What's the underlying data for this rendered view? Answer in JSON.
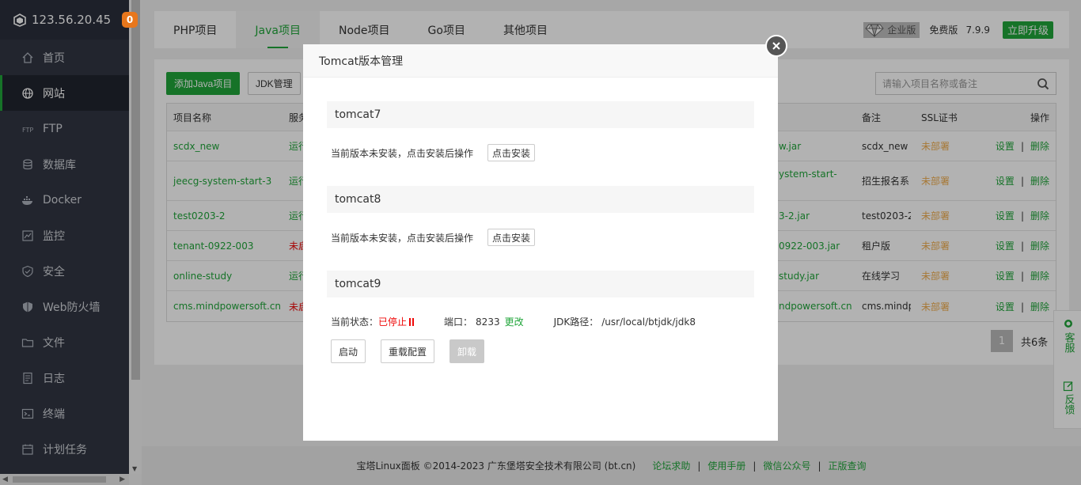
{
  "sidebar": {
    "ip": "123.56.20.45",
    "badge": "0",
    "items": [
      {
        "label": "首页",
        "icon": "home-icon"
      },
      {
        "label": "网站",
        "icon": "globe-icon"
      },
      {
        "label": "FTP",
        "icon": "ftp-icon"
      },
      {
        "label": "数据库",
        "icon": "database-icon"
      },
      {
        "label": "Docker",
        "icon": "docker-icon"
      },
      {
        "label": "监控",
        "icon": "monitor-icon"
      },
      {
        "label": "安全",
        "icon": "shield-icon"
      },
      {
        "label": "Web防火墙",
        "icon": "firewall-icon"
      },
      {
        "label": "文件",
        "icon": "folder-icon"
      },
      {
        "label": "日志",
        "icon": "log-icon"
      },
      {
        "label": "终端",
        "icon": "terminal-icon"
      },
      {
        "label": "计划任务",
        "icon": "calendar-icon"
      }
    ],
    "active_index": 1
  },
  "topnav": {
    "tabs": [
      "PHP项目",
      "Java项目",
      "Node项目",
      "Go项目",
      "其他项目"
    ],
    "active_index": 1,
    "enterprise": "企业版",
    "free": "免费版",
    "version": "7.9.9",
    "upgrade": "立即升级"
  },
  "toolbar": {
    "add_java": "添加Java项目",
    "jdk_manage": "JDK管理",
    "search_placeholder": "请输入项目名称或备注"
  },
  "table": {
    "headers": {
      "name": "项目名称",
      "status": "服务",
      "note": "备注",
      "ssl": "SSL证书",
      "op": "操作"
    },
    "rows": [
      {
        "name": "scdx_new",
        "status": "运行",
        "status_color": "green",
        "path": "w.jar",
        "note": "scdx_new",
        "ssl": "未部署"
      },
      {
        "name": "jeecg-system-start-3",
        "status": "运行",
        "status_color": "green",
        "path": "ystem-start-",
        "note": "招生报名系",
        "ssl": "未部署"
      },
      {
        "name": "test0203-2",
        "status": "运行",
        "status_color": "green",
        "path": "3-2.jar",
        "note": "test0203-2",
        "ssl": "未部署"
      },
      {
        "name": "tenant-0922-003",
        "status": "未启",
        "status_color": "red",
        "path": "0922-003.jar",
        "note": "租户版",
        "ssl": "未部署"
      },
      {
        "name": "online-study",
        "status": "运行",
        "status_color": "green",
        "path": "study.jar",
        "note": "在线学习",
        "ssl": "未部署"
      },
      {
        "name": "cms.mindpowersoft.cn",
        "status": "未启",
        "status_color": "red",
        "path": "ndpowersoft.cn",
        "note": "cms.mindp",
        "ssl": "未部署"
      }
    ],
    "op_set": "设置",
    "op_sep": "|",
    "op_del": "删除"
  },
  "pager": {
    "page": "1",
    "total": "共6条"
  },
  "footer": {
    "copyright": "宝塔Linux面板 ©2014-2023 广东堡塔安全技术有限公司 (bt.cn)",
    "links": [
      "论坛求助",
      "使用手册",
      "微信公众号",
      "正版查询"
    ],
    "sep": "|"
  },
  "float": {
    "service": "客服",
    "feedback": "反馈"
  },
  "modal": {
    "title": "Tomcat版本管理",
    "tomcat7": {
      "title": "tomcat7",
      "msg": "当前版本未安装，点击安装后操作",
      "install": "点击安装"
    },
    "tomcat8": {
      "title": "tomcat8",
      "msg": "当前版本未安装，点击安装后操作",
      "install": "点击安装"
    },
    "tomcat9": {
      "title": "tomcat9",
      "status_label": "当前状态：",
      "status_value": "已停止",
      "port_label": "端口：",
      "port_value": "8233",
      "port_change": "更改",
      "jdk_label": "JDK路径：",
      "jdk_value": "/usr/local/btjdk/jdk8",
      "start": "启动",
      "reload": "重载配置",
      "uninstall": "卸载"
    }
  },
  "colors": {
    "accent": "#20a53a",
    "sidebar": "#313643",
    "danger": "#ef0808",
    "warn": "#f0ad4e"
  }
}
